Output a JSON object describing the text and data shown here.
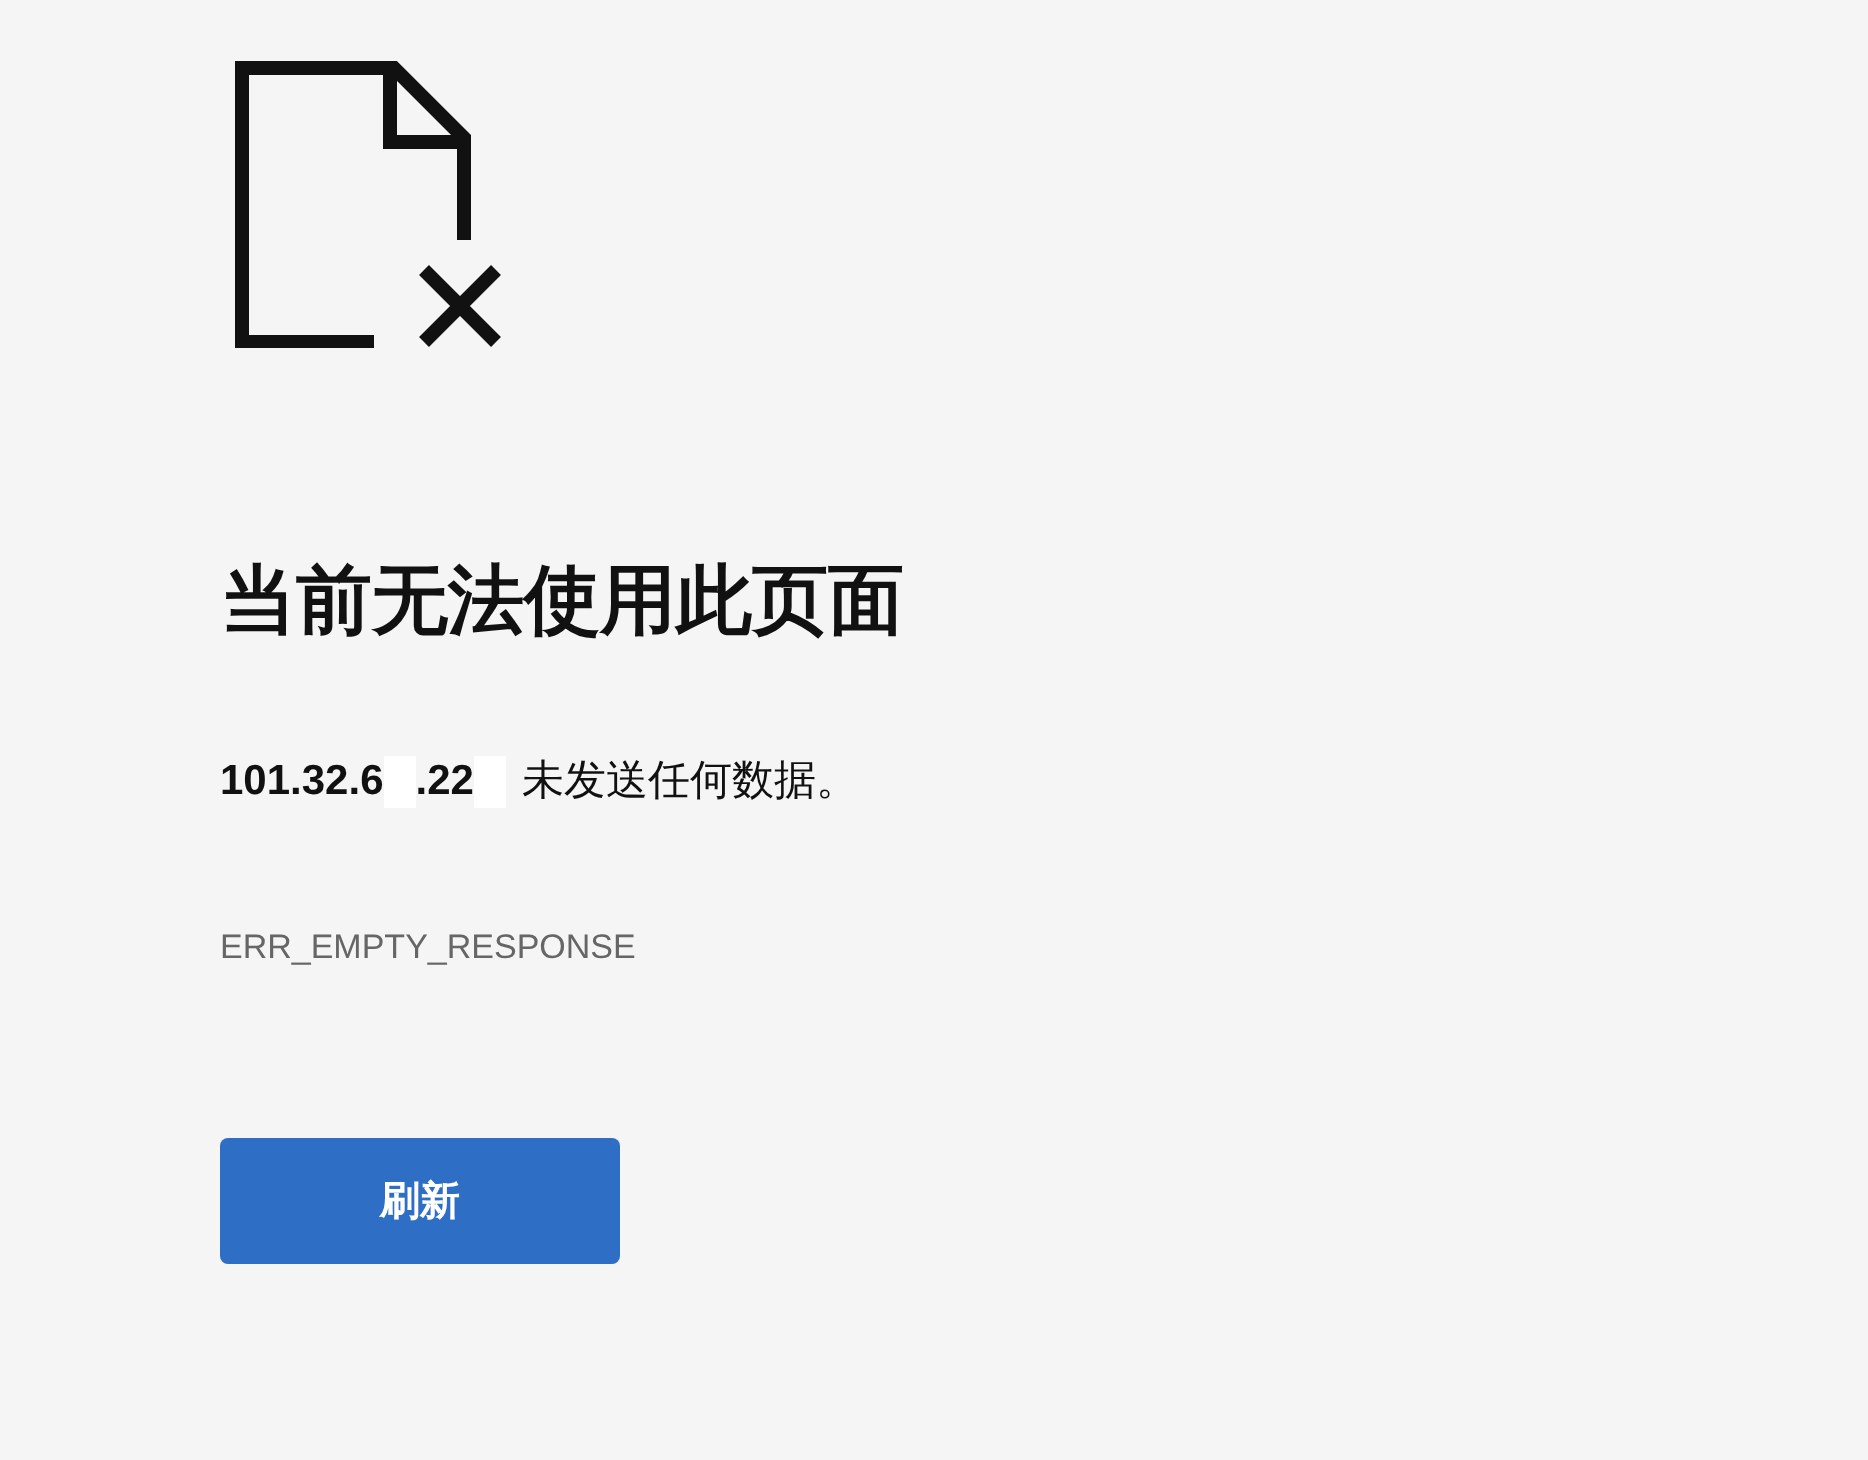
{
  "title": "当前无法使用此页面",
  "message": {
    "host_parts": [
      {
        "kind": "text",
        "text": "101.32.6"
      },
      {
        "kind": "redacted"
      },
      {
        "kind": "text",
        "text": ".22"
      },
      {
        "kind": "redacted"
      }
    ],
    "text": "未发送任何数据。"
  },
  "error_code": "ERR_EMPTY_RESPONSE",
  "buttons": [
    {
      "label": "刷新"
    }
  ]
}
